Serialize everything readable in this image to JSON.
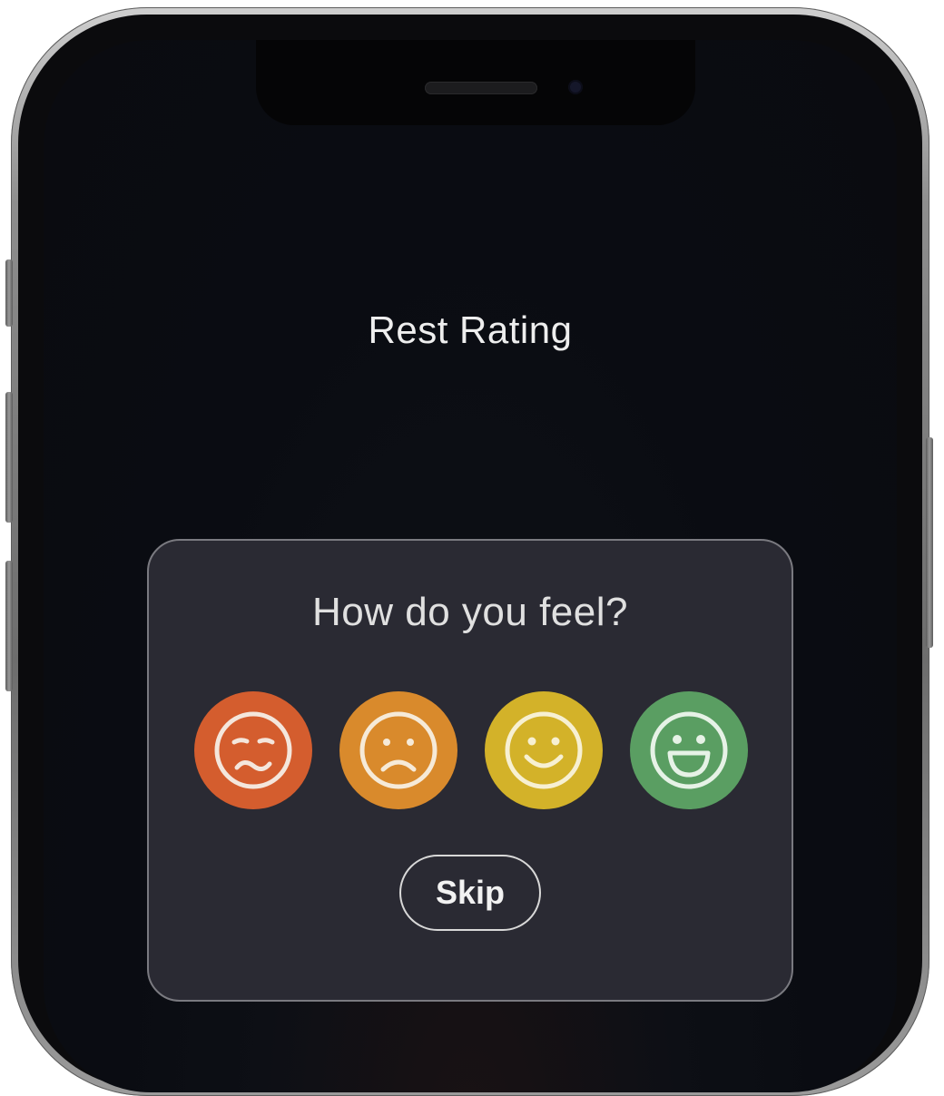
{
  "screen": {
    "title": "Rest Rating"
  },
  "dialog": {
    "prompt": "How do you feel?",
    "options": [
      {
        "name": "very-bad",
        "icon": "worried-face-icon",
        "color": "#d45d2e"
      },
      {
        "name": "bad",
        "icon": "sad-face-icon",
        "color": "#d98a2c"
      },
      {
        "name": "good",
        "icon": "smile-face-icon",
        "color": "#d3b229"
      },
      {
        "name": "great",
        "icon": "grin-face-icon",
        "color": "#5a9e62"
      }
    ],
    "skip_label": "Skip"
  }
}
